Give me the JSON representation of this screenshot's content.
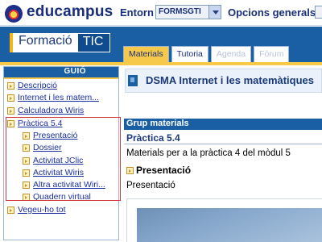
{
  "topbar": {
    "logo_text": "educampus",
    "entorn_label": "Entorn",
    "entorn_select_value": "FORMSGTI",
    "opcions_label": "Opcions generals"
  },
  "course_header": {
    "brand_left": "Formació",
    "brand_right": "TIC",
    "tabs": [
      {
        "label": "Materials",
        "state": "active"
      },
      {
        "label": "Tutoria",
        "state": "normal"
      },
      {
        "label": "Agenda",
        "state": "disabled"
      },
      {
        "label": "Fòrum",
        "state": "disabled"
      }
    ]
  },
  "sidebar": {
    "title": "GUIÓ",
    "items": [
      {
        "label": "Descripció"
      },
      {
        "label": "Internet i les matem..."
      },
      {
        "label": "Calculadora Wiris"
      },
      {
        "label": "Pràctica 5.4"
      },
      {
        "label": "Presentació"
      },
      {
        "label": "Dossier"
      },
      {
        "label": "Activitat JClic"
      },
      {
        "label": "Activitat Wiris"
      },
      {
        "label": "Altra activitat Wiri..."
      },
      {
        "label": "Quadern virtual"
      },
      {
        "label": "Vegeu-ho tot"
      }
    ]
  },
  "main": {
    "course_title": "DSMA Internet i les matemàtiques",
    "group_header": "Grup materials",
    "practice_title": "Pràctica 5.4",
    "practice_desc": "Materials per a la pràctica 4 del mòdul 5",
    "section_title": "Presentació",
    "section_text": "Presentació"
  },
  "colors": {
    "brand_blue": "#1a5ea3",
    "accent_yellow": "#f6c94a",
    "link_blue": "#1a2fa0",
    "highlight_red": "#d6363a"
  }
}
